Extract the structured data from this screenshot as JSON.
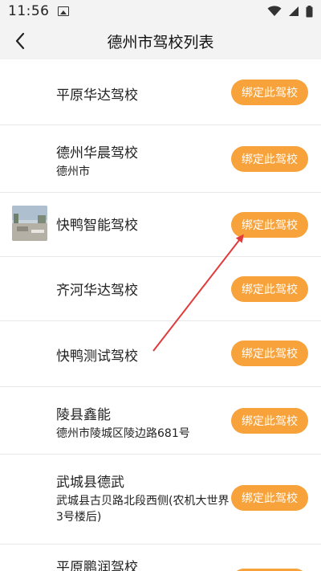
{
  "status_bar": {
    "time": "11:56",
    "icons": [
      "image-icon",
      "wifi-icon",
      "cellular-icon",
      "battery-icon"
    ]
  },
  "nav": {
    "title": "德州市驾校列表",
    "back_icon": "chevron-left-icon"
  },
  "bind_label": "绑定此驾校",
  "schools": [
    {
      "name": "平原华达驾校",
      "address": ""
    },
    {
      "name": "德州华晨驾校",
      "address": "德州市"
    },
    {
      "name": "快鸭智能驾校",
      "address": "",
      "has_thumbnail": true
    },
    {
      "name": "齐河华达驾校",
      "address": ""
    },
    {
      "name": "快鸭测试驾校",
      "address": ""
    },
    {
      "name": "陵县鑫能",
      "address": "德州市陵城区陵边路681号"
    },
    {
      "name": "武城县德武",
      "address": "武城县古贝路北段西侧(农机大世界3号楼后)"
    },
    {
      "name": "平原鹏润驾校",
      "address": ""
    }
  ],
  "colors": {
    "accent": "#f7a23b",
    "annotation_arrow": "#e23b3b",
    "divider": "#e8e8e8"
  }
}
